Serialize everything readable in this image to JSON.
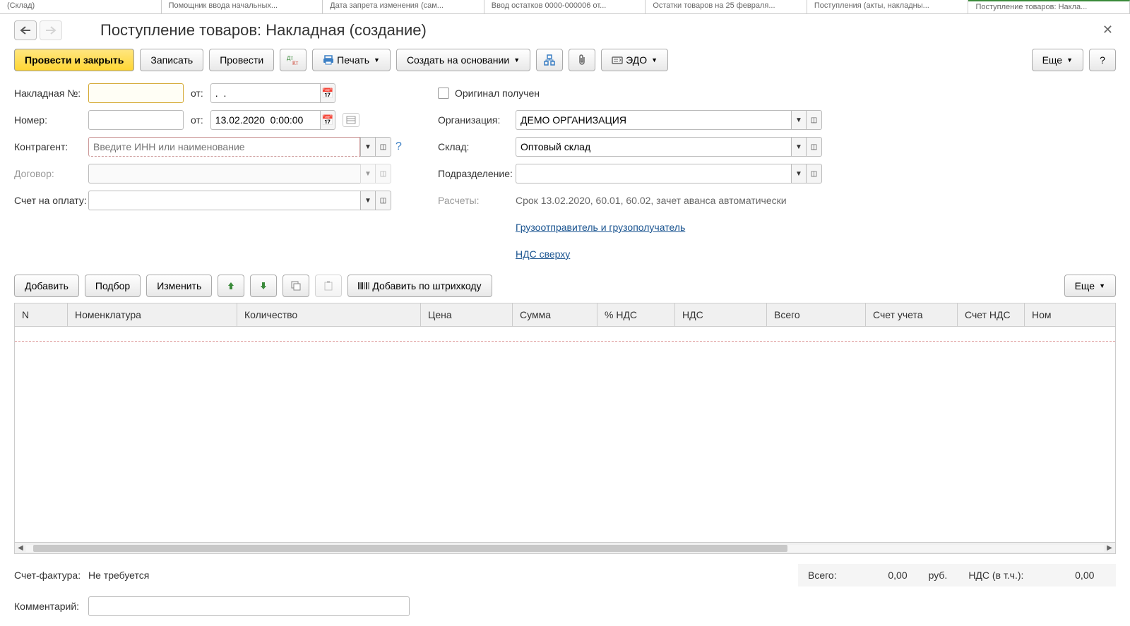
{
  "tabs": [
    "(Склад)",
    "Помощник ввода начальных...",
    "Дата запрета изменения (сам...",
    "Ввод остатков 0000-000006 от...",
    "Остатки товаров на 25 февраля...",
    "Поступления (акты, накладны...",
    "Поступление товаров: Накла..."
  ],
  "title": "Поступление товаров: Накладная (создание)",
  "toolbar": {
    "post_close": "Провести и закрыть",
    "save": "Записать",
    "post": "Провести",
    "print": "Печать",
    "create_based": "Создать на основании",
    "edo": "ЭДО",
    "more": "Еще",
    "help": "?"
  },
  "form": {
    "invoice_no_label": "Накладная №:",
    "invoice_no": "",
    "from_label": "от:",
    "invoice_date": ".  .",
    "number_label": "Номер:",
    "number": "",
    "number_date": "13.02.2020  0:00:00",
    "counterparty_label": "Контрагент:",
    "counterparty_placeholder": "Введите ИНН или наименование",
    "contract_label": "Договор:",
    "invoice_account_label": "Счет на оплату:",
    "original_received": "Оригинал получен",
    "organization_label": "Организация:",
    "organization": "ДЕМО ОРГАНИЗАЦИЯ",
    "warehouse_label": "Склад:",
    "warehouse": "Оптовый склад",
    "subdivision_label": "Подразделение:",
    "settlements_label": "Расчеты:",
    "settlements_value": "Срок 13.02.2020, 60.01, 60.02, зачет аванса автоматически",
    "link_consignor": "Грузоотправитель и грузополучатель",
    "link_vat": "НДС сверху"
  },
  "table_toolbar": {
    "add": "Добавить",
    "pick": "Подбор",
    "change": "Изменить",
    "add_barcode": "Добавить по штрихкоду",
    "more": "Еще"
  },
  "table": {
    "headers": [
      "N",
      "Номенклатура",
      "Количество",
      "Цена",
      "Сумма",
      "% НДС",
      "НДС",
      "Всего",
      "Счет учета",
      "Счет НДС",
      "Ном"
    ]
  },
  "footer": {
    "invoice_label": "Счет-фактура:",
    "invoice_value": "Не требуется",
    "comment_label": "Комментарий:",
    "total_label": "Всего:",
    "total_value": "0,00",
    "currency": "руб.",
    "vat_label": "НДС (в т.ч.):",
    "vat_value": "0,00"
  }
}
